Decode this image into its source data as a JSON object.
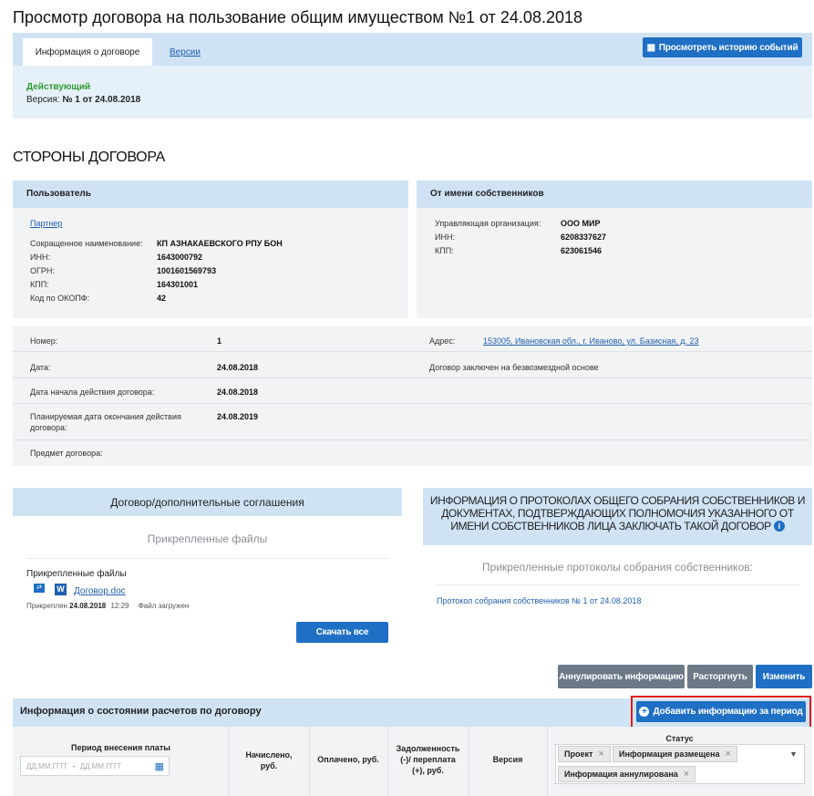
{
  "page": {
    "title": "Просмотр договора на пользование общим имуществом №1 от 24.08.2018"
  },
  "tabs": {
    "info": "Информация о договоре",
    "versions": "Версии"
  },
  "history_button": "Просмотреть историю событий",
  "status": {
    "text": "Действующий",
    "version_label": "Версия:",
    "version_value": "№ 1 от 24.08.2018",
    "color": "#2e9b2e"
  },
  "parties": {
    "heading": "СТОРОНЫ ДОГОВОРА",
    "user": {
      "title": "Пользователь",
      "link": "Партнер",
      "rows": [
        {
          "label": "Сокращенное наименование:",
          "value": "КП АЗНАКАЕВСКОГО РПУ БОН"
        },
        {
          "label": "ИНН:",
          "value": "1643000792"
        },
        {
          "label": "ОГРН:",
          "value": "1001601569793"
        },
        {
          "label": "КПП:",
          "value": "164301001"
        },
        {
          "label": "Код по ОКОПФ:",
          "value": "42"
        }
      ]
    },
    "owners": {
      "title": "От имени собственников",
      "rows": [
        {
          "label": "Управляющая организация:",
          "value": "ООО МИР"
        },
        {
          "label": "ИНН:",
          "value": "6208337627"
        },
        {
          "label": "КПП:",
          "value": "623061546"
        }
      ]
    }
  },
  "details": {
    "number_label": "Номер:",
    "number_value": "1",
    "address_label": "Адрес:",
    "address_value": "153005, Ивановская обл., г. Иваново, ул. Базисная, д. 23",
    "date_label": "Дата:",
    "date_value": "24.08.2018",
    "free_basis": "Договор заключен на безвозмездной основе",
    "start_label": "Дата начала действия договора:",
    "start_value": "24.08.2018",
    "end_label_1": "Планируемая дата окончания действия",
    "end_label_2": "договора:",
    "end_value": "24.08.2019",
    "subject_label": "Предмет договора:"
  },
  "contracts_panel": {
    "title": "Договор/дополнительные соглашения",
    "files_heading": "Прикрепленные файлы",
    "files_label": "Прикрепленные файлы",
    "file_name": "Договор.doc",
    "attached_prefix": "Прикреплен",
    "attached_date": "24.08.2018",
    "attached_time": "12:29",
    "file_status": "Файл загружен",
    "download_all": "Скачать все"
  },
  "protocols_panel": {
    "title_1": "ИНФОРМАЦИЯ О ПРОТОКОЛАХ ОБЩЕГО СОБРАНИЯ СОБСТВЕННИКОВ И",
    "title_2": "ДОКУМЕНТАХ, ПОДТВЕРЖДАЮЩИХ ПОЛНОМОЧИЯ УКАЗАННОГО ОТ",
    "title_3": "ИМЕНИ СОБСТВЕННИКОВ ЛИЦА ЗАКЛЮЧАТЬ ТАКОЙ ДОГОВОР",
    "subheading": "Прикрепленные протоколы собрания собственников:",
    "protocol_link": "Протокол собрания собственников № 1 от 24.08.2018"
  },
  "actions": {
    "annul": "Аннулировать информацию",
    "terminate": "Расторгнуть",
    "edit": "Изменить"
  },
  "settlements": {
    "title": "Информация о состоянии расчетов по договору",
    "add_button": "Добавить информацию за период",
    "columns": {
      "period": "Период внесения платы",
      "accrued_1": "Начислено,",
      "accrued_2": "руб.",
      "paid": "Оплачено, руб.",
      "debt_1": "Задолженность",
      "debt_2": "(-)/ переплата",
      "debt_3": "(+), руб.",
      "version": "Версия",
      "status": "Статус"
    },
    "date_from_placeholder": "ДД.ММ.ГГГГ",
    "date_sep": "-",
    "date_to_placeholder": "ДД.ММ.ГГГГ",
    "status_tags": [
      "Проект",
      "Информация размещена",
      "Информация аннулирована"
    ]
  },
  "colors": {
    "accent": "#1f6fc5",
    "panel_head": "#cfe3f5",
    "highlight": "#e01a1a"
  }
}
